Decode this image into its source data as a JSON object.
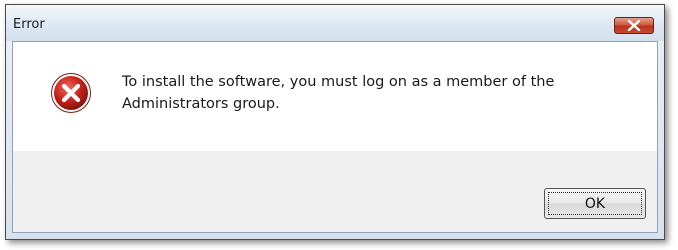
{
  "dialog": {
    "title": "Error",
    "close_icon": "close-icon",
    "error_icon": "error-icon",
    "message": "To install the software, you must log on as a member of the Administrators group.",
    "ok_label": "OK"
  },
  "colors": {
    "error_icon_fill": "#c4231a",
    "close_button": "#c8432c"
  }
}
